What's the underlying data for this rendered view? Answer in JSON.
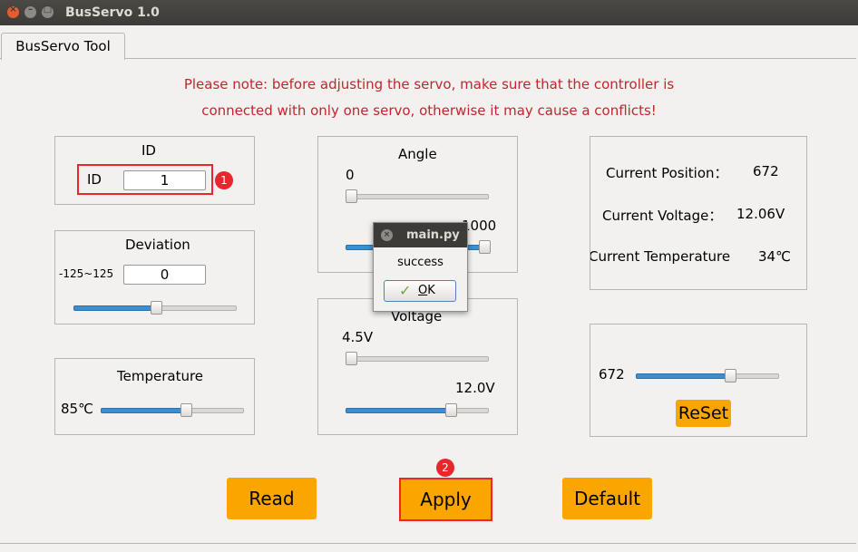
{
  "window": {
    "title": "BusServo 1.0"
  },
  "tab": {
    "label": "BusServo Tool"
  },
  "note": {
    "line1": "Please note: before adjusting the servo, make sure that the controller is",
    "line2": "connected with only one servo, otherwise it may cause a conflicts!"
  },
  "id_group": {
    "title": "ID",
    "label": "ID",
    "value": "1",
    "badge": "1"
  },
  "deviation_group": {
    "title": "Deviation",
    "range_label": "-125~125",
    "value": "0",
    "slider_fraction": 0.5
  },
  "temperature_group": {
    "title": "Temperature",
    "value_label": "85℃",
    "slider_fraction": 0.6
  },
  "angle_group": {
    "title": "Angle",
    "min_value": "0",
    "max_value": "1000",
    "min_slider_fraction": 0.0,
    "max_slider_fraction": 1.0
  },
  "voltage_group": {
    "title": "Voltage",
    "min_value": "4.5V",
    "max_value": "12.0V",
    "min_slider_fraction": 0.0,
    "max_slider_fraction": 0.75
  },
  "status_group": {
    "position_label": "Current Position：",
    "position_value": "672",
    "voltage_label": "Current Voltage：",
    "voltage_value": "12.06V",
    "temperature_label": "Current Temperature",
    "temperature_value": "34℃"
  },
  "reset_group": {
    "value_label": "672",
    "slider_fraction": 0.67,
    "button_label": "ReSet"
  },
  "buttons": {
    "read": "Read",
    "apply": "Apply",
    "default": "Default",
    "apply_badge": "2"
  },
  "dialog": {
    "title": "main.py",
    "message": "success",
    "ok_mnemonic": "O",
    "ok_rest": "K"
  },
  "colors": {
    "accent_orange": "#fba500",
    "note_red": "#c0262d",
    "highlight_red": "#e8262b",
    "slider_blue": "#3b8fd0"
  }
}
